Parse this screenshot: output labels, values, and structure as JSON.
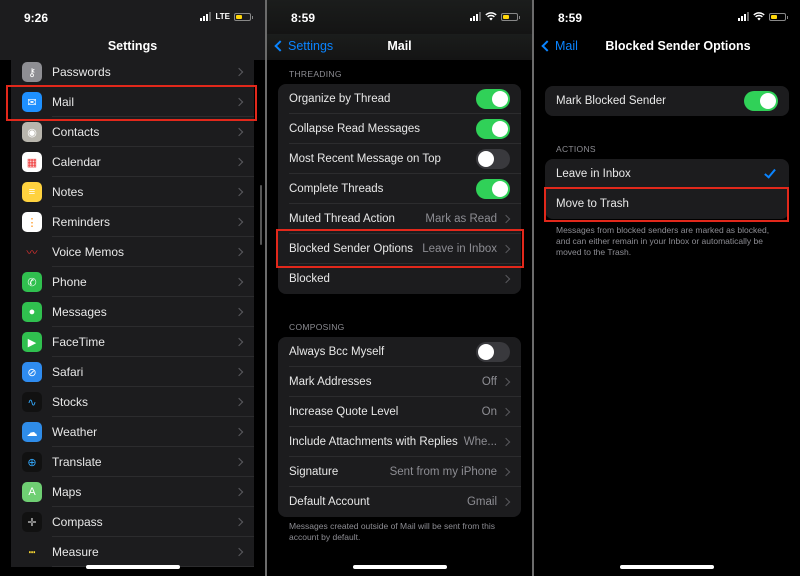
{
  "colors": {
    "accent": "#0a84ff",
    "toggle_on": "#30d158",
    "highlight": "#e2281b",
    "battery": "#ffd60a"
  },
  "panel1": {
    "status": {
      "time": "9:26",
      "network": "LTE"
    },
    "title": "Settings",
    "items": [
      {
        "label": "Passwords",
        "icon": "key-icon"
      },
      {
        "label": "Mail",
        "icon": "mail-icon"
      },
      {
        "label": "Contacts",
        "icon": "contacts-icon"
      },
      {
        "label": "Calendar",
        "icon": "calendar-icon"
      },
      {
        "label": "Notes",
        "icon": "notes-icon"
      },
      {
        "label": "Reminders",
        "icon": "reminders-icon"
      },
      {
        "label": "Voice Memos",
        "icon": "voice-memos-icon"
      },
      {
        "label": "Phone",
        "icon": "phone-icon"
      },
      {
        "label": "Messages",
        "icon": "messages-icon"
      },
      {
        "label": "FaceTime",
        "icon": "facetime-icon"
      },
      {
        "label": "Safari",
        "icon": "safari-icon"
      },
      {
        "label": "Stocks",
        "icon": "stocks-icon"
      },
      {
        "label": "Weather",
        "icon": "weather-icon"
      },
      {
        "label": "Translate",
        "icon": "translate-icon"
      },
      {
        "label": "Maps",
        "icon": "maps-icon"
      },
      {
        "label": "Compass",
        "icon": "compass-icon"
      },
      {
        "label": "Measure",
        "icon": "measure-icon"
      }
    ]
  },
  "panel2": {
    "status": {
      "time": "8:59"
    },
    "back_label": "Settings",
    "title": "Mail",
    "threading": {
      "header": "THREADING",
      "rows": [
        {
          "label": "Organize by Thread",
          "type": "toggle",
          "on": true
        },
        {
          "label": "Collapse Read Messages",
          "type": "toggle",
          "on": true
        },
        {
          "label": "Most Recent Message on Top",
          "type": "toggle",
          "on": false
        },
        {
          "label": "Complete Threads",
          "type": "toggle",
          "on": true
        },
        {
          "label": "Muted Thread Action",
          "type": "link",
          "value": "Mark as Read"
        },
        {
          "label": "Blocked Sender Options",
          "type": "link",
          "value": "Leave in Inbox"
        },
        {
          "label": "Blocked",
          "type": "link",
          "value": ""
        }
      ]
    },
    "composing": {
      "header": "COMPOSING",
      "rows": [
        {
          "label": "Always Bcc Myself",
          "type": "toggle",
          "on": false
        },
        {
          "label": "Mark Addresses",
          "type": "link",
          "value": "Off"
        },
        {
          "label": "Increase Quote Level",
          "type": "link",
          "value": "On"
        },
        {
          "label": "Include Attachments with Replies",
          "type": "link",
          "value": "Whe..."
        },
        {
          "label": "Signature",
          "type": "link",
          "value": "Sent from my iPhone"
        },
        {
          "label": "Default Account",
          "type": "link",
          "value": "Gmail"
        }
      ],
      "footer": "Messages created outside of Mail will be sent from this account by default."
    }
  },
  "panel3": {
    "status": {
      "time": "8:59"
    },
    "back_label": "Mail",
    "title": "Blocked Sender Options",
    "mark_blocked": {
      "label": "Mark Blocked Sender",
      "on": true
    },
    "actions": {
      "header": "ACTIONS",
      "options": [
        {
          "label": "Leave in Inbox",
          "selected": true
        },
        {
          "label": "Move to Trash",
          "selected": false
        }
      ],
      "footer": "Messages from blocked senders are marked as blocked, and can either remain in your Inbox or automatically be moved to the Trash."
    }
  }
}
